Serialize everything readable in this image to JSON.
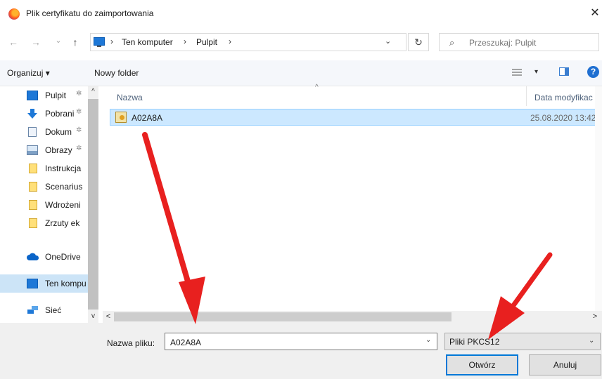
{
  "window": {
    "title": "Plik certyfikatu do zaimportowania",
    "close_glyph": "✕"
  },
  "nav": {
    "back_glyph": "←",
    "forward_glyph": "→",
    "recent_glyph": "⌄",
    "up_glyph": "↑",
    "breadcrumbs": [
      "Ten komputer",
      "Pulpit"
    ],
    "separator": "›",
    "dropdown_glyph": "⌄",
    "refresh_glyph": "↻",
    "search_placeholder": "Przeszukaj: Pulpit"
  },
  "toolbar": {
    "organize_label": "Organizuj ▾",
    "new_folder_label": "Nowy folder",
    "view_dropdown_glyph": "▾",
    "help_glyph": "?"
  },
  "sidebar": {
    "items": [
      {
        "label": "Pulpit",
        "icon": "desktop-icon",
        "pinned": true
      },
      {
        "label": "Pobrani",
        "icon": "download-icon",
        "pinned": true
      },
      {
        "label": "Dokum",
        "icon": "document-icon",
        "pinned": true
      },
      {
        "label": "Obrazy",
        "icon": "pictures-icon",
        "pinned": true
      },
      {
        "label": "Instrukcja",
        "icon": "folder-icon",
        "pinned": false
      },
      {
        "label": "Scenarius",
        "icon": "folder-icon",
        "pinned": false
      },
      {
        "label": "Wdrożeni",
        "icon": "folder-icon",
        "pinned": false
      },
      {
        "label": "Zrzuty ek",
        "icon": "folder-icon",
        "pinned": false
      },
      {
        "label": "OneDrive",
        "icon": "cloud-icon",
        "pinned": false
      },
      {
        "label": "Ten kompu",
        "icon": "computer-icon",
        "pinned": false
      },
      {
        "label": "Sieć",
        "icon": "network-icon",
        "pinned": false
      }
    ],
    "pin_glyph": "✲"
  },
  "files": {
    "columns": {
      "name": "Nazwa",
      "date": "Data modyfikac"
    },
    "rows": [
      {
        "name": "A02A8A",
        "date": "25.08.2020 13:42",
        "icon": "certificate-icon"
      }
    ]
  },
  "bottom": {
    "filename_label": "Nazwa pliku:",
    "filename_value": "A02A8A",
    "filter_value": "Pliki PKCS12",
    "open_label": "Otwórz",
    "cancel_label": "Anuluj"
  },
  "colors": {
    "accent": "#0078d7",
    "selection": "#cce8ff",
    "arrow": "#e8201f"
  }
}
